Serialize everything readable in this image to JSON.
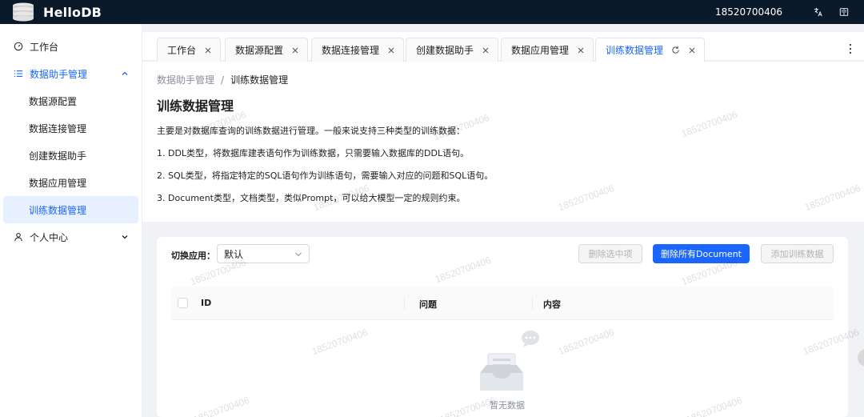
{
  "app": {
    "title": "HelloDB",
    "user_id": "18520700406",
    "icons": [
      "database-logo",
      "translate-icon",
      "book-icon"
    ]
  },
  "sidebar": {
    "items": [
      {
        "label": "工作台",
        "icon": "dashboard-icon"
      },
      {
        "label": "数据助手管理",
        "icon": "list-icon",
        "expanded": true,
        "children": [
          {
            "label": "数据源配置"
          },
          {
            "label": "数据连接管理"
          },
          {
            "label": "创建数据助手"
          },
          {
            "label": "数据应用管理"
          },
          {
            "label": "训练数据管理",
            "active": true
          }
        ]
      },
      {
        "label": "个人中心",
        "icon": "user-icon",
        "expanded": false
      }
    ]
  },
  "tabs": [
    {
      "label": "工作台"
    },
    {
      "label": "数据源配置"
    },
    {
      "label": "数据连接管理"
    },
    {
      "label": "创建数据助手"
    },
    {
      "label": "数据应用管理"
    },
    {
      "label": "训练数据管理",
      "active": true
    }
  ],
  "breadcrumb": {
    "parent": "数据助手管理",
    "separator": "/",
    "current": "训练数据管理"
  },
  "page": {
    "title": "训练数据管理",
    "intro": "主要是对数据库查询的训练数据进行管理。一般来说支持三种类型的训练数据：",
    "points": [
      "1. DDL类型，将数据库建表语句作为训练数据，只需要输入数据库的DDL语句。",
      "2. SQL类型，将指定特定的SQL语句作为训练语句，需要输入对应的问题和SQL语句。",
      "3. Document类型，文档类型，类似Prompt，可以给大模型一定的规则约束。"
    ]
  },
  "toolbar": {
    "switch_label": "切换应用：",
    "select_value": "默认",
    "delete_selected": "删除选中项",
    "delete_all_docs": "删除所有Document",
    "add_training": "添加训练数据"
  },
  "table": {
    "columns": [
      "ID",
      "问题",
      "内容"
    ],
    "empty_text": "暂无数据"
  },
  "watermark": "18520700406",
  "colors": {
    "header_bg": "#0b1a2b",
    "accent": "#1a66ff",
    "active_bg": "#e6f0ff"
  }
}
